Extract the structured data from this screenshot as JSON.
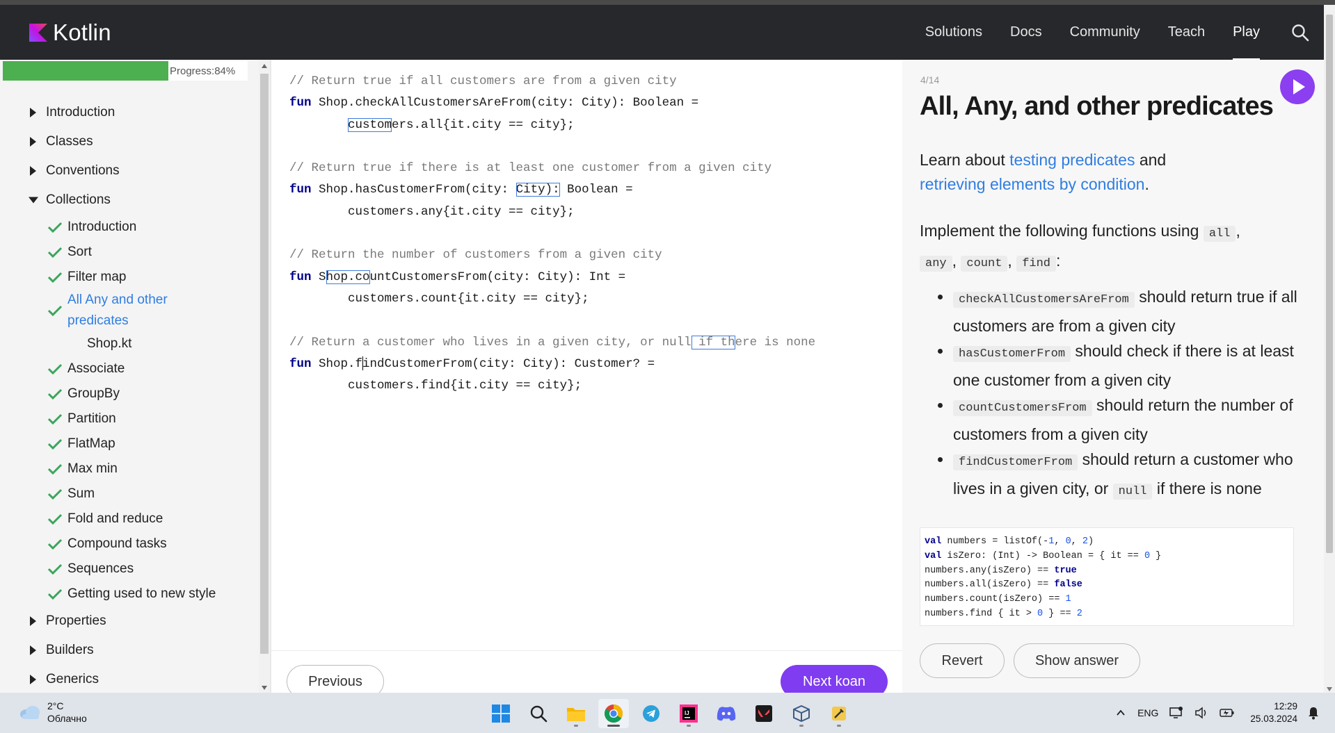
{
  "header": {
    "brand": "Kotlin",
    "nav": [
      "Solutions",
      "Docs",
      "Community",
      "Teach",
      "Play"
    ],
    "active_nav": "Play"
  },
  "sidebar": {
    "progress_label": "Progress:84%",
    "progress_value": 0.84,
    "top_sections": {
      "introduction": "Introduction",
      "classes": "Classes",
      "conventions": "Conventions",
      "collections": "Collections",
      "properties": "Properties",
      "builders": "Builders",
      "generics": "Generics"
    },
    "collections_items": [
      "Introduction",
      "Sort",
      "Filter map",
      "All Any and other predicates",
      "Associate",
      "GroupBy",
      "Partition",
      "FlatMap",
      "Max min",
      "Sum",
      "Fold and reduce",
      "Compound tasks",
      "Sequences",
      "Getting used to new style"
    ],
    "active_item_line1": "All Any and other",
    "active_item_line2": "predicates",
    "active_file": "Shop.kt"
  },
  "editor": {
    "c1": "// Return true if all customers are from a given city",
    "c2": "// Return true if there is at least one customer from a given city",
    "c3": "// Return the number of customers from a given city",
    "c4": "// Return a customer who lives in a given city, or null if there is none",
    "kw": "fun",
    "f1_sig": " Shop.checkAllCustomersAreFrom(city: City): Boolean =",
    "f1_body_a": "custom",
    "f1_body_b": "ers.all{it.city == city};",
    "f2_sig_a": " Shop.hasCustomerFrom(city: ",
    "f2_sig_sel": "City):",
    "f2_sig_b": " Boolean =",
    "f2_body": "customers.any{it.city == city};",
    "f3_sig_a": " S",
    "f3_sig_sel": "hop.co",
    "f3_sig_b": "untCustomersFrom(city: City): Int =",
    "f3_body": "customers.count{it.city == city};",
    "f4_sig_a": " Shop.f",
    "f4_sig_b": "indCustomerFrom(city: City): Customer? =",
    "f4_body": "customers.find{it.city == city};",
    "c4_a": "// Return a customer who lives in a given city, or null",
    "c4_sel": " if th",
    "c4_b": "ere is none",
    "prev_label": "Previous",
    "next_label": "Next koan"
  },
  "description": {
    "counter": "4/14",
    "title": "All, Any, and other predicates",
    "p1_a": "Learn about ",
    "p1_link1": "testing predicates",
    "p1_b": " and",
    "p1_link2": "retrieving elements by condition",
    "p1_c": ".",
    "p2_a": "Implement the following functions using ",
    "p2_all": "all",
    "p2_any": "any",
    "p2_count": "count",
    "p2_find": "find",
    "p2_comma": ",",
    "p2_colon": ":",
    "items": [
      {
        "code": "checkAllCustomersAreFrom",
        "text": " should return true if all customers are from a given city"
      },
      {
        "code": "hasCustomerFrom",
        "text": " should check if there is at least one customer from a given city"
      },
      {
        "code": "countCustomersFrom",
        "text": " should return the number of customers from a given city"
      }
    ],
    "item4_code": "findCustomerFrom",
    "item4_text_a": " should return a customer who lives in a given city, or ",
    "item4_null": "null",
    "item4_text_b": " if there is none",
    "sample": {
      "l1_kw": "val",
      "l1_rest": " numbers = listOf(-",
      "l1_n1": "1",
      "l1_c1": ", ",
      "l1_n2": "0",
      "l1_c2": ", ",
      "l1_n3": "2",
      "l1_end": ")",
      "l2_kw": "val",
      "l2_rest": " isZero: (Int) -> Boolean = { it == ",
      "l2_n": "0",
      "l2_end": " }",
      "l3_rest": "numbers.any(isZero) == ",
      "l3_kw": "true",
      "l4_rest": "numbers.all(isZero) == ",
      "l4_kw": "false",
      "l5_rest": "numbers.count(isZero) == ",
      "l5_n": "1",
      "l6_rest": "numbers.find { it > ",
      "l6_n": "0",
      "l6_mid": " } == ",
      "l6_n2": "2"
    },
    "revert_label": "Revert",
    "show_answer_label": "Show answer"
  },
  "taskbar": {
    "temperature": "2°C",
    "weather": "Облачно",
    "language": "ENG",
    "time": "12:29",
    "date": "25.03.2024",
    "apps": [
      "start-icon",
      "search-icon",
      "file-explorer-icon",
      "chrome-icon",
      "telegram-icon",
      "intellij-icon",
      "discord-icon",
      "valorant-icon",
      "virtualbox-icon",
      "tools-icon"
    ]
  }
}
